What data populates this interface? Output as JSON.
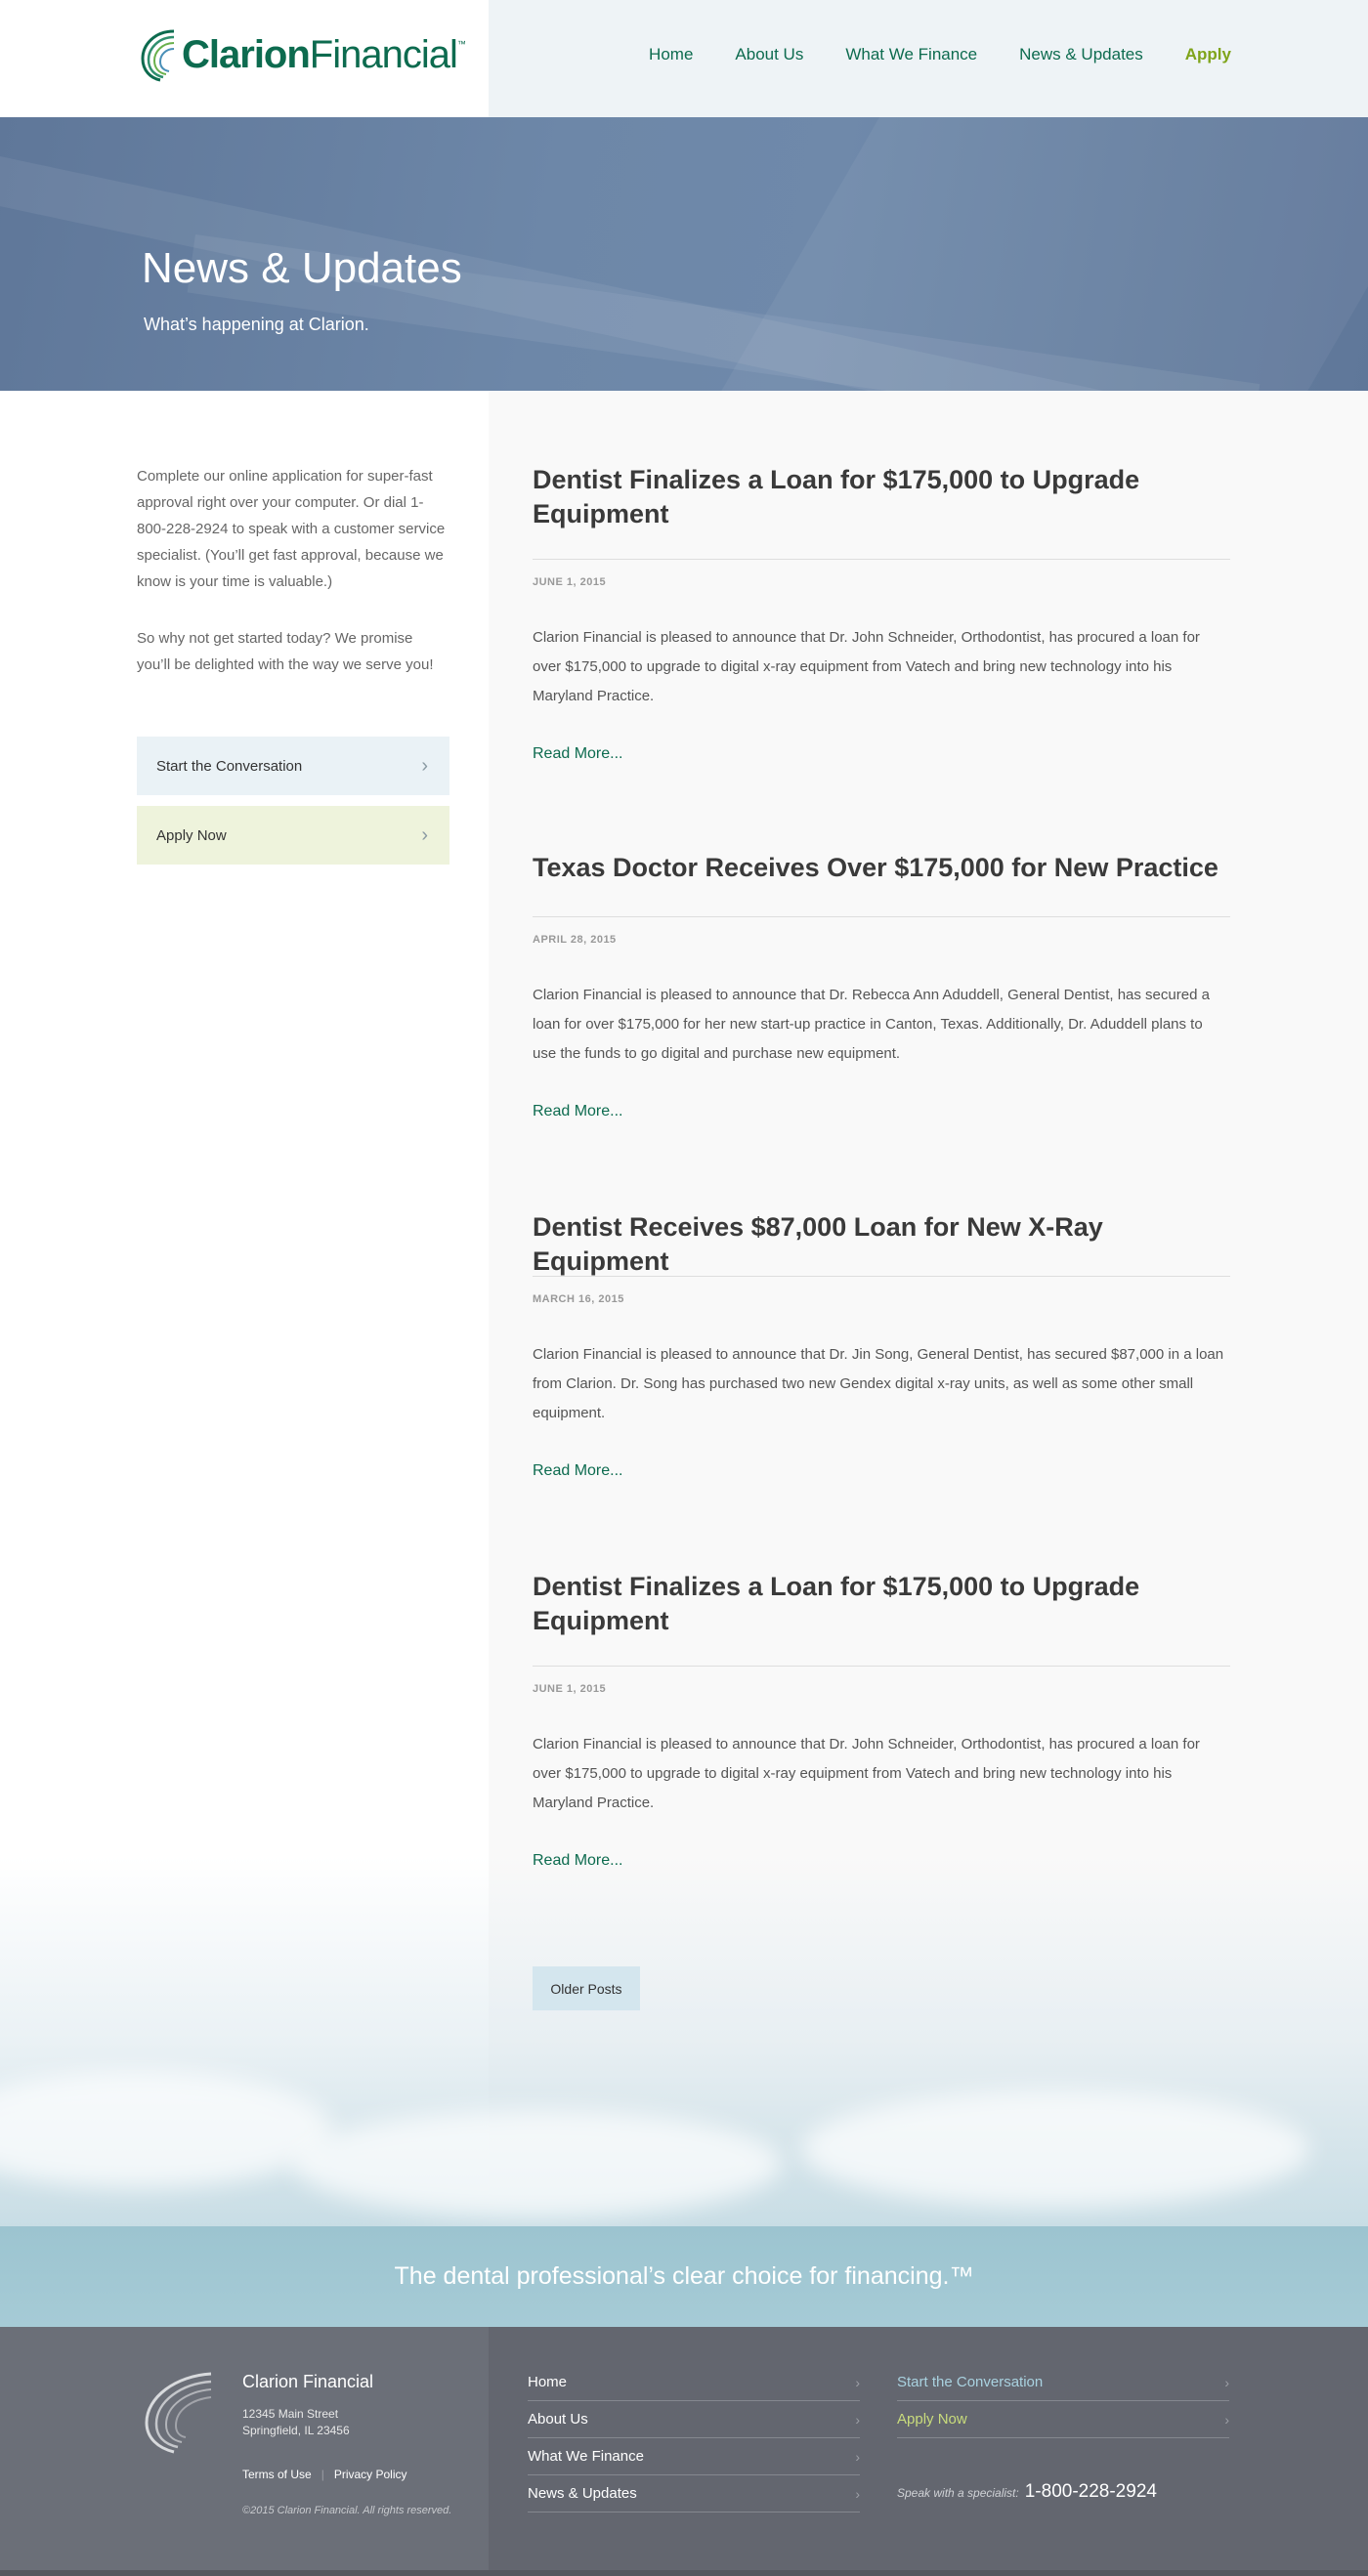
{
  "header": {
    "logo_text_bold": "Clarion",
    "logo_text_light": "Financial",
    "logo_tm": "™",
    "nav": [
      "Home",
      "About Us",
      "What We Finance",
      "News & Updates",
      "Apply"
    ]
  },
  "hero": {
    "title": "News & Updates",
    "subtitle": "What’s happening at Clarion."
  },
  "sidebar": {
    "para1": "Complete our online application for super-fast approval right over your computer. Or dial 1-800-228-2924 to speak with a customer service specialist. (You’ll get fast approval, because we know is your time is valuable.)",
    "para2": "So why not get started today? We promise you’ll be delighted with the way we serve you!",
    "btn_conversation": "Start the Conversation",
    "btn_apply": "Apply Now",
    "chevron": "›"
  },
  "posts": [
    {
      "title": "Dentist Finalizes a Loan for $175,000 to Upgrade Equipment",
      "date": "JUNE 1, 2015",
      "body": "Clarion Financial is pleased to announce that Dr. John Schneider, Orthodontist, has procured a loan for over $175,000 to upgrade to digital x-ray equipment from Vatech and bring new technology into his Maryland Practice.",
      "more": "Read More..."
    },
    {
      "title": "Texas Doctor Receives Over $175,000 for New Practice",
      "date": "APRIL 28, 2015",
      "body": "Clarion Financial is pleased to announce that Dr. Rebecca Ann Aduddell, General Dentist, has secured a loan for over $175,000 for her new start-up practice in Canton, Texas. Additionally, Dr. Aduddell plans to use the funds to go digital and purchase new equipment.",
      "more": "Read More..."
    },
    {
      "title": "Dentist Receives $87,000 Loan for New X-Ray Equipment",
      "date": "MARCH 16, 2015",
      "body": "Clarion Financial is pleased to announce that Dr. Jin Song, General Dentist, has secured $87,000 in a loan from Clarion. Dr. Song has purchased two new Gendex digital x-ray units, as well as some other small equipment.",
      "more": "Read More..."
    },
    {
      "title": "Dentist Finalizes a Loan for $175,000 to Upgrade Equipment",
      "date": "JUNE 1, 2015",
      "body": "Clarion Financial is pleased to announce that Dr. John Schneider, Orthodontist, has procured a loan for over $175,000 to upgrade to digital x-ray equipment from Vatech and bring new technology into his Maryland Practice.",
      "more": "Read More..."
    }
  ],
  "older_posts": "Older Posts",
  "tagline": "The dental professional’s clear choice for financing.™",
  "footer": {
    "brand": "Clarion Financial",
    "address1": "12345 Main Street",
    "address2": "Springfield, IL 23456",
    "terms": "Terms of Use",
    "separator": "|",
    "privacy": "Privacy Policy",
    "copyright": "©2015 Clarion Financial. All rights reserved.",
    "nav": [
      "Home",
      "About Us",
      "What We Finance",
      "News & Updates"
    ],
    "cta_conversation": "Start the Conversation",
    "cta_apply": "Apply Now",
    "phone_label": "Speak with a specialist:",
    "phone": "1-800-228-2924",
    "chevron": "›"
  },
  "colors": {
    "brand_green": "#0d6b4f",
    "apply_green": "#7fa41a",
    "hero_blue": "#6d87a8",
    "footer_gray": "#63666f"
  }
}
